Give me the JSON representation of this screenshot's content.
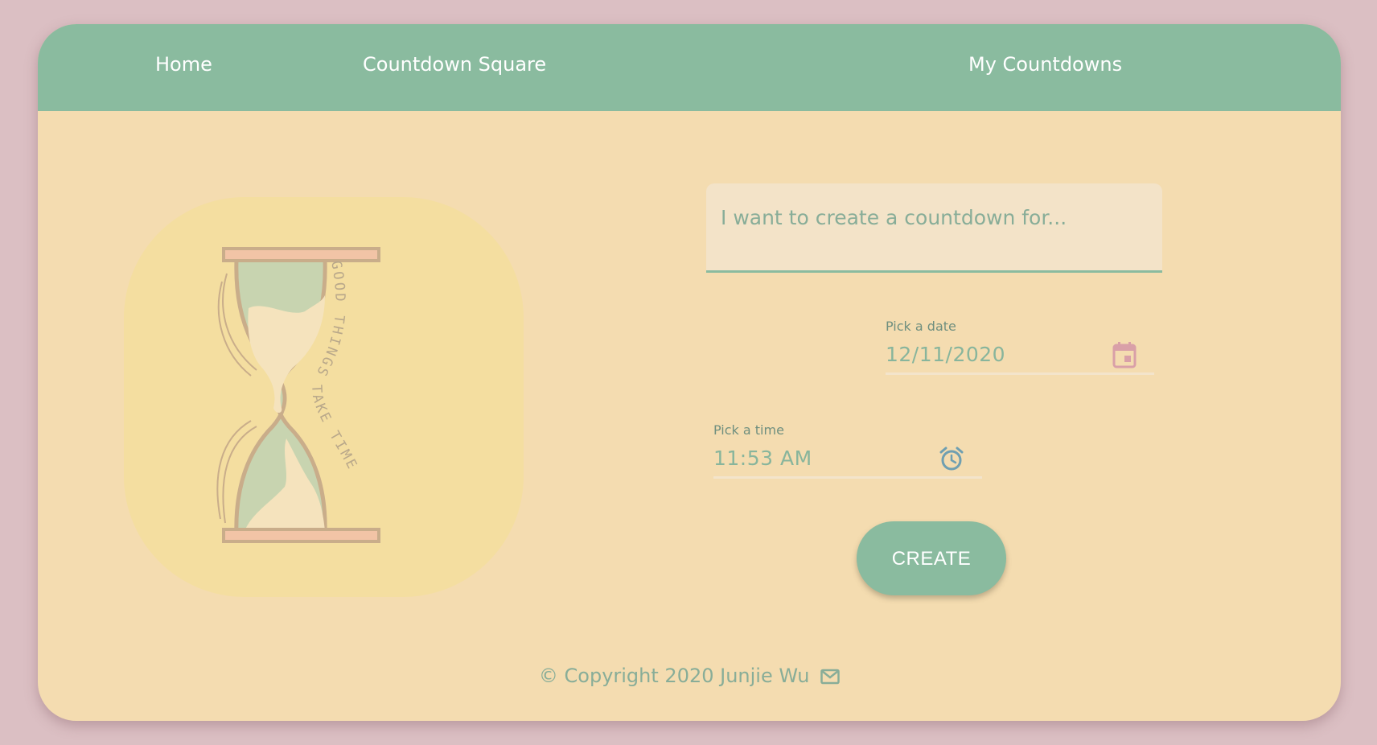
{
  "nav": {
    "home_label": "Home",
    "square_label": "Countdown Square",
    "mine_label": "My Countdowns"
  },
  "illustration": {
    "arc_text": "GOOD THINGS TAKE TIME",
    "icon": "hourglass-icon"
  },
  "form": {
    "title_placeholder": "I want to create a countdown for...",
    "title_value": "",
    "date_label": "Pick a date",
    "date_value": "12/11/2020",
    "date_icon": "calendar-icon",
    "time_label": "Pick a time",
    "time_value": "11:53 AM",
    "time_icon": "alarm-clock-icon",
    "create_label": "CREATE"
  },
  "footer": {
    "copyright": "© Copyright 2020 Junjie Wu",
    "mail_icon": "mail-icon"
  },
  "colors": {
    "page_bg": "#dbbfc3",
    "card_bg": "#f4dcb0",
    "accent_green": "#8abb9f",
    "calendar_pink": "#d9a0a8",
    "clock_blue": "#6f9fb1"
  }
}
